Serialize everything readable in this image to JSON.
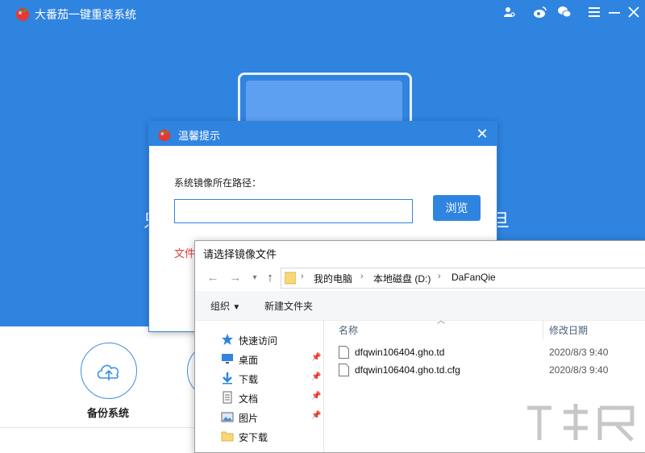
{
  "app": {
    "title": "大番茄一键重装系统",
    "hero": {
      "left_glyph": "只",
      "right_glyph": "旦"
    },
    "functions": [
      {
        "label": "备份系统",
        "icon": "cloud-upload-icon"
      }
    ],
    "toolbar_icons": [
      "user-search-icon",
      "weibo-icon",
      "wechat-icon",
      "menu-icon",
      "minimize-icon",
      "close-icon"
    ],
    "accent_color": "#2f84e0"
  },
  "tip_dialog": {
    "title": "温馨提示",
    "path_label": "系统镜像所在路径：",
    "path_value": "",
    "browse_label": "浏览",
    "file_text": "文件"
  },
  "file_dialog": {
    "title": "请选择镜像文件",
    "breadcrumb": [
      "我的电脑",
      "本地磁盘 (D:)",
      "DaFanQie"
    ],
    "toolbar": {
      "organize": "组织",
      "new_folder": "新建文件夹"
    },
    "nav_items": [
      {
        "label": "快速访问",
        "icon": "star-icon",
        "pinned": false
      },
      {
        "label": "桌面",
        "icon": "desktop-icon",
        "pinned": true
      },
      {
        "label": "下载",
        "icon": "download-icon",
        "pinned": true
      },
      {
        "label": "文档",
        "icon": "document-icon",
        "pinned": true
      },
      {
        "label": "图片",
        "icon": "pictures-icon",
        "pinned": true
      },
      {
        "label": "安下载",
        "icon": "folder-icon",
        "pinned": false
      }
    ],
    "columns": {
      "name": "名称",
      "date": "修改日期"
    },
    "files": [
      {
        "name": "dfqwin106404.gho.td",
        "date": "2020/8/3 9:40"
      },
      {
        "name": "dfqwin106404.gho.td.cfg",
        "date": "2020/8/3 9:40"
      }
    ]
  }
}
